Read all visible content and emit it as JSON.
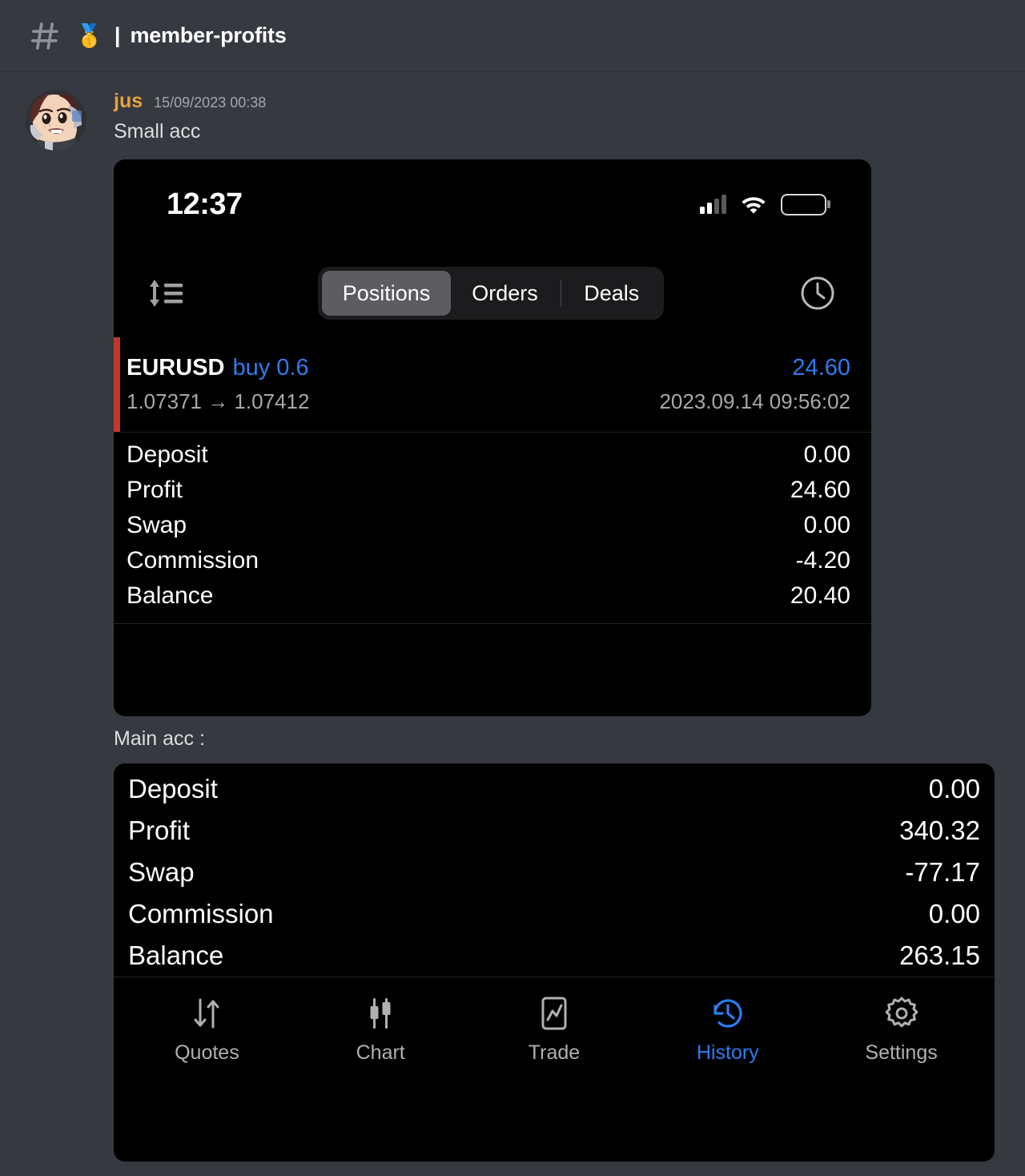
{
  "header": {
    "hash_icon": "hash-icon",
    "emoji": "🥇",
    "separator": "|",
    "channel_name": "member-profits"
  },
  "message": {
    "author": "jus",
    "timestamp": "15/09/2023 00:38",
    "text_first": "Small acc",
    "text_second": "Main acc :"
  },
  "screenshot_small": {
    "status_bar": {
      "time": "12:37",
      "signal_icon": "cellular-signal-icon",
      "wifi_icon": "wifi-icon",
      "battery_icon": "battery-low-power-icon",
      "battery_color": "#f5cf49"
    },
    "toolbar": {
      "sort_icon": "sort-icon",
      "clock_icon": "clock-icon",
      "tabs": [
        {
          "label": "Positions",
          "active": true
        },
        {
          "label": "Orders",
          "active": false
        },
        {
          "label": "Deals",
          "active": false
        }
      ]
    },
    "position": {
      "symbol": "EURUSD",
      "side": "buy 0.6",
      "profit": "24.60",
      "prices": "1.07371 → 1.07412",
      "datetime": "2023.09.14 09:56:02",
      "accent_color": "#c0392b",
      "profit_color": "#2d7cf0"
    },
    "summary": [
      {
        "label": "Deposit",
        "value": "0.00"
      },
      {
        "label": "Profit",
        "value": "24.60"
      },
      {
        "label": "Swap",
        "value": "0.00"
      },
      {
        "label": "Commission",
        "value": "-4.20"
      },
      {
        "label": "Balance",
        "value": "20.40"
      }
    ]
  },
  "screenshot_main": {
    "summary": [
      {
        "label": "Deposit",
        "value": "0.00"
      },
      {
        "label": "Profit",
        "value": "340.32"
      },
      {
        "label": "Swap",
        "value": "-77.17"
      },
      {
        "label": "Commission",
        "value": "0.00"
      },
      {
        "label": "Balance",
        "value": "263.15"
      }
    ],
    "tab_bar": [
      {
        "label": "Quotes",
        "icon": "quotes-arrows-icon",
        "active": false
      },
      {
        "label": "Chart",
        "icon": "candlestick-icon",
        "active": false
      },
      {
        "label": "Trade",
        "icon": "trade-chart-icon",
        "active": false
      },
      {
        "label": "History",
        "icon": "history-clock-icon",
        "active": true
      },
      {
        "label": "Settings",
        "icon": "gear-icon",
        "active": false
      }
    ],
    "active_color": "#2d7cf0"
  }
}
